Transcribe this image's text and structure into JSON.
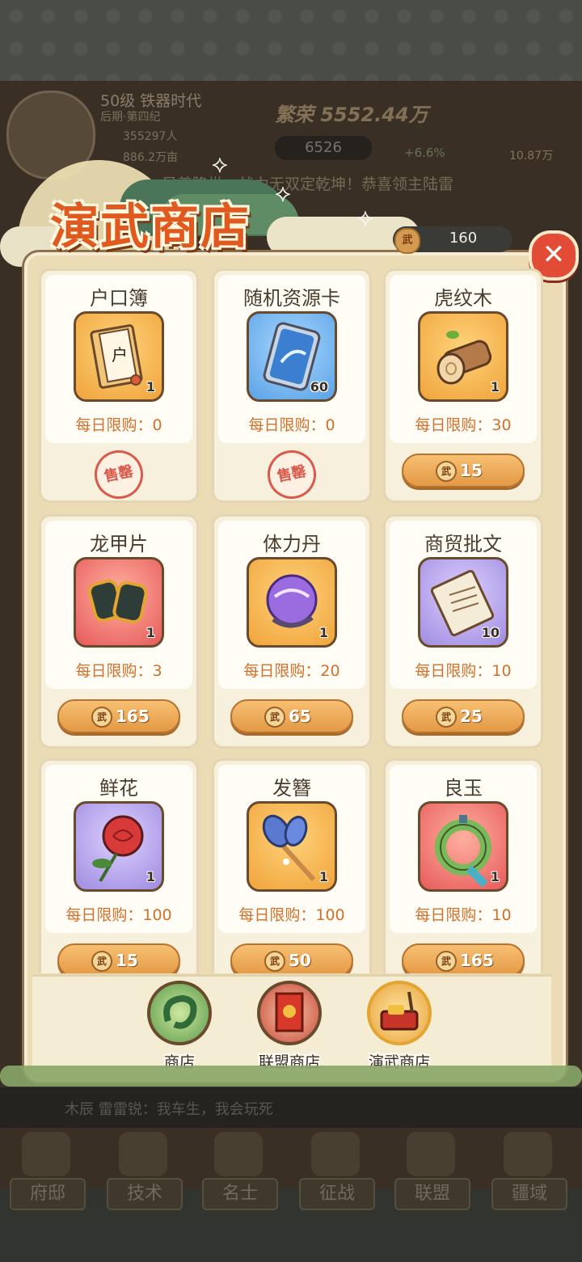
{
  "background_hud": {
    "level": "50级 铁器时代",
    "era": "后期·第四纪",
    "population": "355297人",
    "land": "886.2万亩",
    "prosperity": "繁荣 5552.44万",
    "resource_value": "6526",
    "growth": "+6.6%",
    "gold": "10.87万",
    "marquee": "吴善降世，战力无双定乾坤！恭喜领主陆雷",
    "chat_text": "木辰  雷雷锐：我车生，我会玩死",
    "nav": [
      "府邸",
      "技术",
      "名士",
      "征战",
      "联盟",
      "疆域"
    ]
  },
  "shop": {
    "title": "演武商店",
    "currency_icon": "武",
    "currency_value": "160",
    "close_icon": "close-icon",
    "limit_prefix": "每日限购：",
    "soldout_label": "售罄",
    "items": [
      {
        "name": "户口簿",
        "qty": "1",
        "limit": "每日限购：0",
        "sold_out": true,
        "frame": "orange",
        "icon": "register-book-icon"
      },
      {
        "name": "随机资源卡",
        "qty": "60",
        "limit": "每日限购：0",
        "sold_out": true,
        "frame": "blue",
        "icon": "resource-card-icon"
      },
      {
        "name": "虎纹木",
        "qty": "1",
        "limit": "每日限购：30",
        "price": "15",
        "frame": "orange",
        "icon": "wood-log-icon"
      },
      {
        "name": "龙甲片",
        "qty": "1",
        "limit": "每日限购：3",
        "price": "165",
        "frame": "red",
        "icon": "dragon-armor-icon"
      },
      {
        "name": "体力丹",
        "qty": "1",
        "limit": "每日限购：20",
        "price": "65",
        "frame": "orange",
        "icon": "stamina-pill-icon"
      },
      {
        "name": "商贸批文",
        "qty": "10",
        "limit": "每日限购：10",
        "price": "25",
        "frame": "purple",
        "icon": "scroll-icon"
      },
      {
        "name": "鲜花",
        "qty": "1",
        "limit": "每日限购：100",
        "price": "15",
        "frame": "purple",
        "icon": "rose-icon"
      },
      {
        "name": "发簪",
        "qty": "1",
        "limit": "每日限购：100",
        "price": "50",
        "frame": "orange",
        "icon": "hairpin-icon"
      },
      {
        "name": "良玉",
        "qty": "1",
        "limit": "每日限购：10",
        "price": "165",
        "frame": "red",
        "icon": "jade-icon"
      }
    ],
    "tabs": [
      {
        "label": "商店",
        "icon": "jade-dragon-icon"
      },
      {
        "label": "联盟商店",
        "icon": "alliance-banner-icon"
      },
      {
        "label": "演武商店",
        "icon": "martial-treasure-icon"
      }
    ]
  },
  "colors": {
    "title": "#e05a20",
    "limit_text": "#d0702a",
    "buy_button": "#e39a45",
    "panel_bg": "#ecdcb6",
    "close_button": "#e24c37"
  }
}
